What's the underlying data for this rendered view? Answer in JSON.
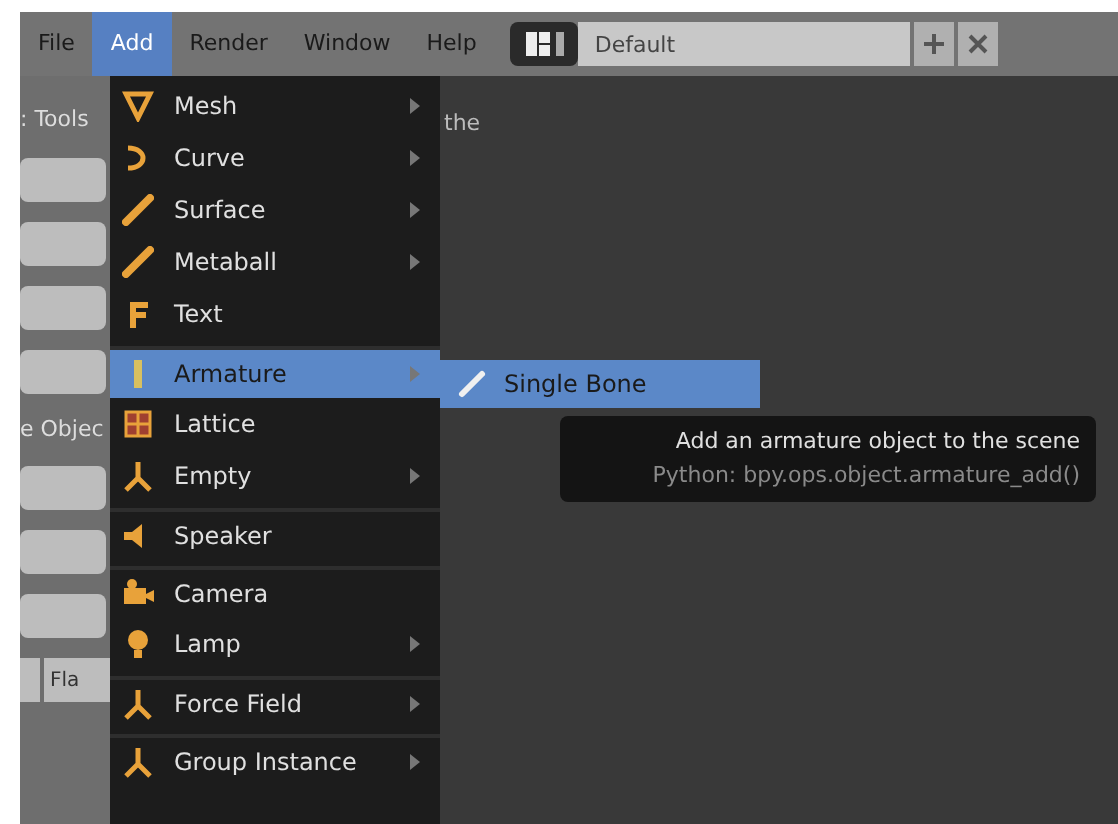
{
  "menubar": {
    "items": [
      {
        "label": "File",
        "selected": false
      },
      {
        "label": "Add",
        "selected": true
      },
      {
        "label": "Render",
        "selected": false
      },
      {
        "label": "Window",
        "selected": false
      },
      {
        "label": "Help",
        "selected": false
      }
    ],
    "layout_field": {
      "value": "Default"
    }
  },
  "left_panel": {
    "title": ": Tools",
    "label": "e Objec",
    "tab": "Fla"
  },
  "viewport_text": "the",
  "add_menu": {
    "items": [
      {
        "label": "Mesh",
        "kind": "mesh",
        "submenu": true,
        "selected": false,
        "separator_before": false
      },
      {
        "label": "Curve",
        "kind": "curve",
        "submenu": true,
        "selected": false,
        "separator_before": false
      },
      {
        "label": "Surface",
        "kind": "surface",
        "submenu": true,
        "selected": false,
        "separator_before": false
      },
      {
        "label": "Metaball",
        "kind": "metaball",
        "submenu": true,
        "selected": false,
        "separator_before": false
      },
      {
        "label": "Text",
        "kind": "text",
        "submenu": false,
        "selected": false,
        "separator_before": false
      },
      {
        "label": "Armature",
        "kind": "armature",
        "submenu": true,
        "selected": true,
        "separator_before": true
      },
      {
        "label": "Lattice",
        "kind": "lattice",
        "submenu": false,
        "selected": false,
        "separator_before": false
      },
      {
        "label": "Empty",
        "kind": "empty",
        "submenu": true,
        "selected": false,
        "separator_before": false
      },
      {
        "label": "Speaker",
        "kind": "speaker",
        "submenu": false,
        "selected": false,
        "separator_before": true
      },
      {
        "label": "Camera",
        "kind": "camera",
        "submenu": false,
        "selected": false,
        "separator_before": true
      },
      {
        "label": "Lamp",
        "kind": "lamp",
        "submenu": true,
        "selected": false,
        "separator_before": false
      },
      {
        "label": "Force Field",
        "kind": "empty",
        "submenu": true,
        "selected": false,
        "separator_before": true
      },
      {
        "label": "Group Instance",
        "kind": "empty",
        "submenu": true,
        "selected": false,
        "separator_before": true
      }
    ]
  },
  "submenu": {
    "items": [
      {
        "label": "Single Bone",
        "selected": true
      }
    ]
  },
  "tooltip": {
    "description": "Add an armature object to the scene",
    "python": "Python: bpy.ops.object.armature_add()"
  }
}
